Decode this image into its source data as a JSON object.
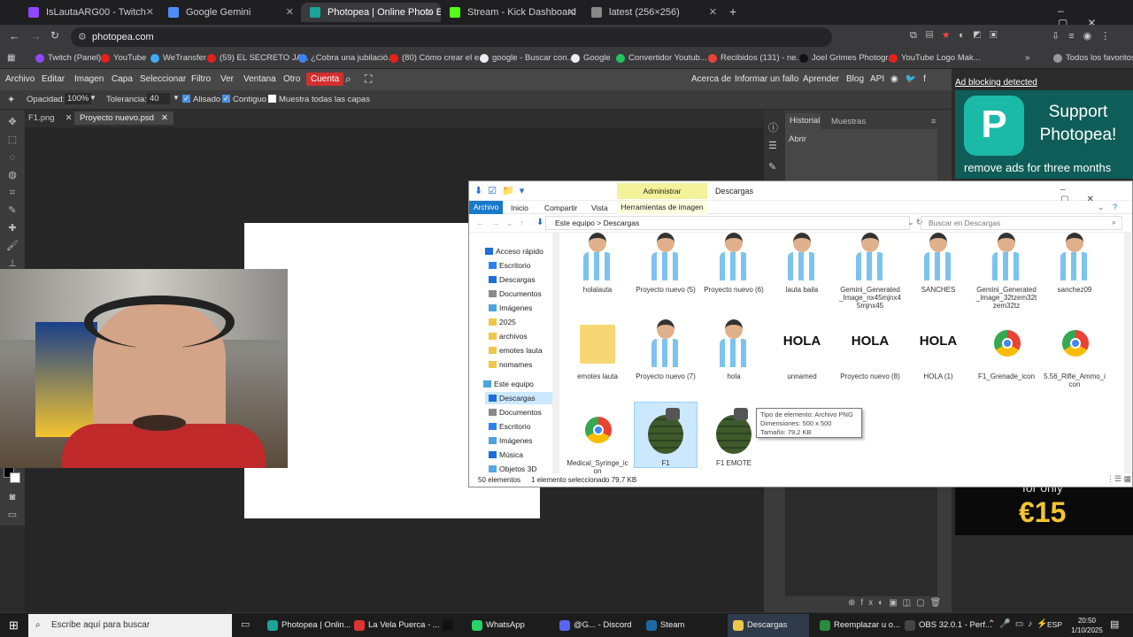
{
  "browser": {
    "tabs": [
      {
        "title": "IsLautaARG00 - Twitch",
        "color": "#9146ff"
      },
      {
        "title": "Google Gemini",
        "color": "#4f8cf7"
      },
      {
        "title": "Photopea | Online Photo Editor",
        "color": "#18a497"
      },
      {
        "title": "Stream - Kick Dashboard",
        "color": "#53fc18"
      },
      {
        "title": "latest (256×256)",
        "color": "#888888"
      }
    ],
    "url": "photopea.com",
    "bookmarks": [
      "Twitch (Panel)",
      "YouTube",
      "WeTransfer",
      "(59) EL SECRETO JA...",
      "¿Cobra una jubilació...",
      "(80) Cómo crear el e...",
      "google - Buscar con...",
      "Google",
      "Convertidor Youtub...",
      "Recibidos (131) - ne...",
      "Joel Grimes Photogr...",
      "YouTube Logo Mak...",
      "Todos los favoritos"
    ]
  },
  "photopea": {
    "menu": [
      "Archivo",
      "Editar",
      "Imagen",
      "Capa",
      "Seleccionar",
      "Filtro",
      "Ver",
      "Ventana",
      "Otro",
      "Cuenta"
    ],
    "right_menu": [
      "Acerca de",
      "Informar un fallo",
      "Aprender",
      "Blog",
      "API"
    ],
    "options": {
      "opacity_label": "Opacidad:",
      "opacity_value": "100%",
      "tolerance_label": "Tolerancia:",
      "tolerance_value": "40",
      "antialias": "Alisado",
      "contiguous": "Contiguo",
      "all_layers": "Muestra todas las capas"
    },
    "doc_tabs": [
      "F1.png",
      "Proyecto nuevo.psd"
    ],
    "panel_tabs": [
      "Historial",
      "Muestras"
    ],
    "history_items": [
      "Abrir"
    ],
    "ad": {
      "notice": "Ad blocking detected",
      "headline": "Support Photopea!",
      "sub": "remove ads for three months",
      "for_only": "for only",
      "price": "€15"
    }
  },
  "explorer": {
    "ribbon_context": "Administrar",
    "title": "Descargas",
    "tabs": [
      "Archivo",
      "Inicio",
      "Compartir",
      "Vista",
      "Herramientas de imagen"
    ],
    "path": [
      "Este equipo",
      "Descargas"
    ],
    "search_placeholder": "Buscar en Descargas",
    "nav": [
      {
        "label": "Acceso rápido",
        "type": "star"
      },
      {
        "label": "Escritorio",
        "type": "blue"
      },
      {
        "label": "Descargas",
        "type": "down"
      },
      {
        "label": "Documentos",
        "type": "doc"
      },
      {
        "label": "Imágenes",
        "type": "img"
      },
      {
        "label": "2025",
        "type": "folder"
      },
      {
        "label": "archivos",
        "type": "folder"
      },
      {
        "label": "emotes lauta",
        "type": "folder"
      },
      {
        "label": "nomames",
        "type": "folder"
      },
      {
        "label": "Este equipo",
        "type": "pc"
      },
      {
        "label": "Descargas",
        "type": "down",
        "selected": true
      },
      {
        "label": "Documentos",
        "type": "doc"
      },
      {
        "label": "Escritorio",
        "type": "blue"
      },
      {
        "label": "Imágenes",
        "type": "img"
      },
      {
        "label": "Música",
        "type": "music"
      },
      {
        "label": "Objetos 3D",
        "type": "blue"
      }
    ],
    "files": [
      {
        "name": "holalauta",
        "kind": "sticker"
      },
      {
        "name": "Proyecto nuevo (5)",
        "kind": "sticker"
      },
      {
        "name": "Proyecto nuevo (6)",
        "kind": "sticker"
      },
      {
        "name": "lauta baila",
        "kind": "sticker"
      },
      {
        "name": "Gemini_Generated_Image_nx45mjnx45mjnx45",
        "kind": "sticker"
      },
      {
        "name": "SANCHES",
        "kind": "sticker"
      },
      {
        "name": "Gemini_Generated_Image_32tzem32tzem32tz",
        "kind": "sticker"
      },
      {
        "name": "sanchez09",
        "kind": "sticker"
      },
      {
        "name": "emotes lauta",
        "kind": "folder"
      },
      {
        "name": "Proyecto nuevo (7)",
        "kind": "sticker"
      },
      {
        "name": "hola",
        "kind": "sticker"
      },
      {
        "name": "unnamed",
        "kind": "hola"
      },
      {
        "name": "Proyecto nuevo (8)",
        "kind": "hola"
      },
      {
        "name": "HOLA (1)",
        "kind": "hola"
      },
      {
        "name": "F1_Grenade_icon",
        "kind": "chrome"
      },
      {
        "name": "5.56_Rifle_Ammo_icon",
        "kind": "chrome"
      },
      {
        "name": "Medical_Syringe_icon",
        "kind": "chrome"
      },
      {
        "name": "F1",
        "kind": "grenade",
        "selected": true
      },
      {
        "name": "F1 EMOTE",
        "kind": "grenade"
      }
    ],
    "tooltip": [
      "Tipo de elemento: Archivo PNG",
      "Dimensiones: 500 x 500",
      "Tamaño: 79,2 KB"
    ],
    "status_count": "50 elementos",
    "status_selected": "1 elemento seleccionado  79,7 KB"
  },
  "taskbar": {
    "search_placeholder": "Escribe aquí para buscar",
    "apps": [
      {
        "label": "Photopea | Onlin...",
        "color": "#18a497"
      },
      {
        "label": "La Vela Puerca - ...",
        "color": "#e0332f"
      },
      {
        "label": "",
        "color": "#111111"
      },
      {
        "label": "WhatsApp",
        "color": "#25d366"
      },
      {
        "label": "@G... - Discord",
        "color": "#5865f2"
      },
      {
        "label": "Steam",
        "color": "#1b2838"
      },
      {
        "label": "Descargas",
        "color": "#f0c64a"
      },
      {
        "label": "Reemplazar u o...",
        "color": "#2b8a3e"
      },
      {
        "label": "OBS 32.0.1 - Perf...",
        "color": "#444444"
      }
    ],
    "lang": "ESP",
    "time": "20:50",
    "date": "1/10/2025"
  }
}
